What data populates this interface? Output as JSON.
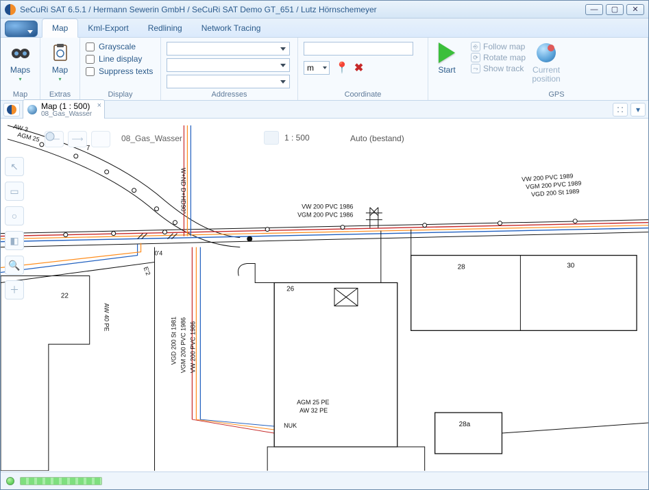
{
  "window": {
    "title": "SeCuRi SAT 6.5.1 / Hermann Sewerin GmbH / SeCuRi SAT Demo GT_651 / Lutz Hörnschemeyer"
  },
  "tabs": {
    "map": "Map",
    "kml": "Kml-Export",
    "redlining": "Redlining",
    "network": "Network Tracing"
  },
  "ribbon": {
    "map_group": {
      "label": "Map",
      "maps_btn": "Maps"
    },
    "extras_group": {
      "label": "Extras",
      "map_btn": "Map"
    },
    "display_group": {
      "label": "Display",
      "grayscale": "Grayscale",
      "line": "Line display",
      "suppress": "Suppress texts"
    },
    "addresses_group": {
      "label": "Addresses"
    },
    "coordinate_group": {
      "label": "Coordinate",
      "unit": "m"
    },
    "start_btn": "Start",
    "gps_group": {
      "label": "GPS",
      "follow": "Follow map",
      "rotate": "Rotate map",
      "track": "Show track",
      "current": "Current",
      "position": "position"
    }
  },
  "doctab": {
    "title": "Map (1 : 500)",
    "subtitle": "08_Gas_Wasser"
  },
  "mapview": {
    "layer_name": "08_Gas_Wasser",
    "scale": "1 : 500",
    "mode": "Auto (bestand)",
    "labels": {
      "aw3": "AW 3",
      "agm25_top": "AGM 25",
      "seven": "7",
      "vert_wnd": "W+ND D+HD90°",
      "zero4": "0'4",
      "e2": "E'2",
      "house22": "22",
      "aw40pe": "AW 40 PE",
      "vw200_1986": "VW 200 PVC 1986",
      "vgm200_1986": "VGM 200 PVC 1986",
      "vgd200_1981": "VGD 200 St 1981",
      "vgm200_1986b": "VGM 200 PVC 1986",
      "vw200_1986b": "VW 200 PVC 1986",
      "vw200_1989": "VW 200 PVC 1989",
      "vgm200_1989": "VGM 200 PVC 1989",
      "vgd200_1989": "VGD 200 St 1989",
      "house26": "26",
      "agm25pe": "AGM 25 PE",
      "aw32pe": "AW 32 PE",
      "nuk": "NUK",
      "house28": "28",
      "house28a": "28a",
      "house30": "30"
    }
  }
}
